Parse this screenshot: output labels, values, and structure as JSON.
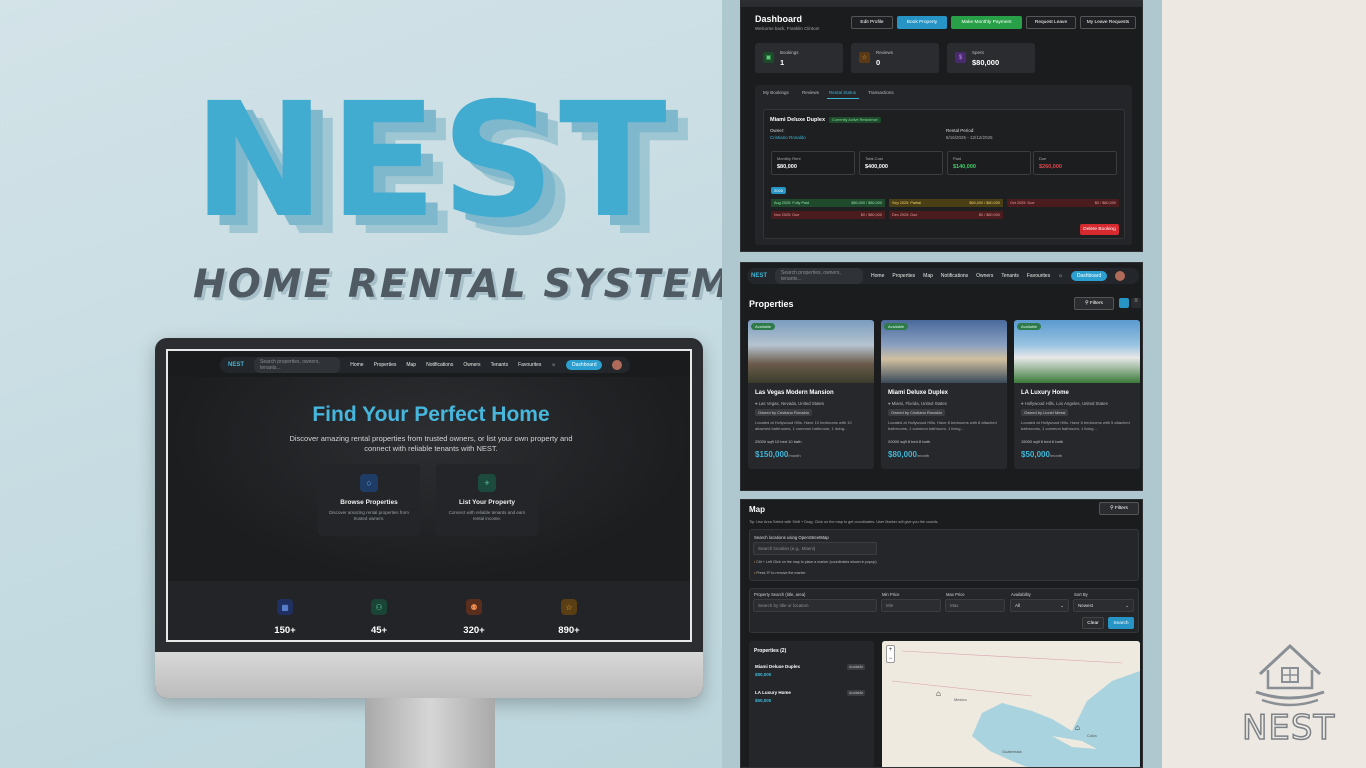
{
  "hero": {
    "brand": "NEST",
    "tagline": "HOME RENTAL SYSTEM"
  },
  "monitor": {
    "nav": {
      "brand": "NEST",
      "search_placeholder": "Search properties, owners, tenants...",
      "items": [
        "Home",
        "Properties",
        "Map",
        "Notifications",
        "Owners",
        "Tenants",
        "Favourites"
      ],
      "dashboard_label": "Dashboard"
    },
    "title": "Find Your Perfect Home",
    "description": "Discover amazing rental properties from trusted owners, or list your own property and connect with reliable tenants with NEST.",
    "cards": [
      {
        "title": "Browse Properties",
        "desc": "Discover amazing rental properties from trusted owners.",
        "icon": "search-icon"
      },
      {
        "title": "List Your Property",
        "desc": "Connect with reliable tenants and earn rental income.",
        "icon": "plus-icon"
      }
    ],
    "stats": [
      {
        "value": "150+",
        "icon": "building-icon",
        "color": "#3b6fd6"
      },
      {
        "value": "45+",
        "icon": "users-icon",
        "color": "#2fa57d"
      },
      {
        "value": "320+",
        "icon": "people-icon",
        "color": "#d9703a"
      },
      {
        "value": "890+",
        "icon": "star-icon",
        "color": "#e0a23a"
      }
    ]
  },
  "dashboard": {
    "title": "Dashboard",
    "welcome": "Welcome back, Franklin Clinton!",
    "buttons": [
      "Edit Profile",
      "Book Property",
      "Make Monthly Payment",
      "Request Leave",
      "My Leave Requests"
    ],
    "stats": [
      {
        "label": "Bookings",
        "value": "1",
        "icon": "calendar-icon",
        "color": "#2f8a4a"
      },
      {
        "label": "Reviews",
        "value": "0",
        "icon": "star-icon",
        "color": "#c77a2a"
      },
      {
        "label": "Spent",
        "value": "$80,000",
        "icon": "dollar-icon",
        "color": "#7a3fc0"
      }
    ],
    "tabs": [
      "My Bookings",
      "Reviews",
      "Rental Status",
      "Transactions"
    ],
    "active_tab": "Rental Status",
    "rental": {
      "property": "Miami Deluxe Duplex",
      "status_badge": "Currently Active Residence",
      "owner_label": "Owner:",
      "owner": "Cristiano Ronaldo",
      "period_label": "Rental Period:",
      "period": "8/16/2025 - 12/12/2025",
      "metrics": [
        {
          "label": "Monthly Rent",
          "value": "$80,000",
          "color": "#ffffff"
        },
        {
          "label": "Total Cost",
          "value": "$400,000",
          "color": "#ffffff"
        },
        {
          "label": "Paid",
          "value": "$140,000",
          "color": "#3fcf6a"
        },
        {
          "label": "Due",
          "value": "$260,000",
          "color": "#e0464a"
        }
      ],
      "year": "2025",
      "payments": [
        {
          "month": "Aug 2025: Fully Paid",
          "amount": "$80,000 / $80,000",
          "status": "paid"
        },
        {
          "month": "Sep 2025: Partial",
          "amount": "$60,000 / $80,000",
          "status": "partial"
        },
        {
          "month": "Oct 2025: Due",
          "amount": "$0 / $80,000",
          "status": "due"
        },
        {
          "month": "Nov 2025: Due",
          "amount": "$0 / $80,000",
          "status": "due"
        },
        {
          "month": "Dec 2025: Due",
          "amount": "$0 / $80,000",
          "status": "due"
        }
      ],
      "delete_label": "Delete Booking"
    }
  },
  "properties": {
    "nav": {
      "brand": "NEST",
      "search_placeholder": "Search properties, owners, tenants...",
      "items": [
        "Home",
        "Properties",
        "Map",
        "Notifications",
        "Owners",
        "Tenants",
        "Favourites"
      ],
      "dashboard_label": "Dashboard"
    },
    "title": "Properties",
    "filters_label": "Filters",
    "cards": [
      {
        "badge": "Available",
        "name": "Las Vegas Modern Mansion",
        "location": "Las Vegas, Nevada, United States",
        "owner": "Owned by Cristiano Ronaldo",
        "desc": "Located at Hollywood Hills. Have 10 bedrooms with 10 attached bathrooms, 1 common bathroom, 1 living...",
        "specs": "25000 sqft    10 bed    10 bath",
        "price": "$150,000",
        "unit": "/month"
      },
      {
        "badge": "Available",
        "name": "Miami Deluxe Duplex",
        "location": "Miami, Florida, United States",
        "owner": "Owned by Cristiano Ronaldo",
        "desc": "Located at Hollywood Hills. Have 8 bedrooms with 8 attached bathrooms, 1 common bathroom, 1 living...",
        "specs": "20000 sqft    8 bed    8 bath",
        "price": "$80,000",
        "unit": "/month"
      },
      {
        "badge": "Available",
        "name": "LA Luxury Home",
        "location": "Hollywood Hills, Los Angeles, United States",
        "owner": "Owned by Lionel Messi",
        "desc": "Located at Hollywood Hills. Have 6 bedrooms with 5 attached bathrooms, 1 common bathroom, 1 living...",
        "specs": "15000 sqft    6 bed    6 bath",
        "price": "$50,000",
        "unit": "/month"
      }
    ]
  },
  "map": {
    "title": "Map",
    "filters_label": "Filters",
    "tip": "Tip: Use Area Select with Shift + Drag. Click on the map to get coordinates. User Marker will give you the coords.",
    "search_section": "Search locations using OpenStreetMap",
    "search_placeholder": "Search location (e.g., Miami)",
    "hint1": "Ctrl + Left Click on the map to place a marker (coordinates shown in popup)",
    "hint2": "Press 'R' to remove the marker",
    "filters": {
      "property_search_label": "Property Search (title, area)",
      "property_search_placeholder": "Search by title or location",
      "min_label": "Min Price",
      "min_placeholder": "Min",
      "max_label": "Max Price",
      "max_placeholder": "Max",
      "availability_label": "Availability",
      "availability_value": "All",
      "sort_label": "Sort By",
      "sort_value": "Newest",
      "clear_label": "Clear",
      "search_label": "Search"
    },
    "list_title": "Properties (2)",
    "list": [
      {
        "name": "Miami Deluxe Duplex",
        "price": "$80,000",
        "badge": "Available"
      },
      {
        "name": "LA Luxury Home",
        "price": "$50,000",
        "badge": "Available"
      }
    ],
    "map_labels": [
      "Mexico",
      "Cuba",
      "Guatemala"
    ]
  },
  "logo": {
    "text": "NEST"
  },
  "colors": {
    "accent": "#41acd0",
    "panel": "#1b1c1e",
    "background": "#c7dce2"
  }
}
